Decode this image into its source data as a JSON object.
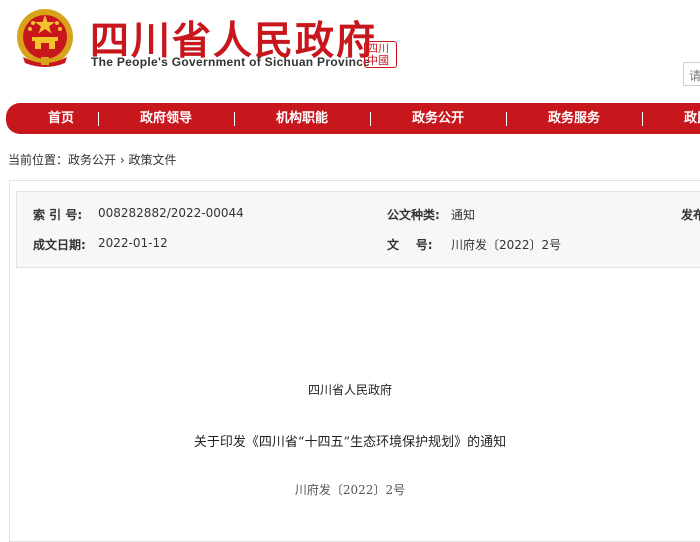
{
  "header": {
    "title_cn": "四川省人民政府",
    "title_en": "The People's Government of Sichuan Province",
    "seal_text": "四川中國",
    "search_placeholder": "请",
    "brand_color": "#c8161d"
  },
  "nav": {
    "items": [
      {
        "label": "首页"
      },
      {
        "label": "政府领导"
      },
      {
        "label": "机构职能"
      },
      {
        "label": "政务公开"
      },
      {
        "label": "政务服务"
      },
      {
        "label": "政民"
      }
    ],
    "separator": "|"
  },
  "breadcrumb": {
    "prefix": "当前位置：",
    "item1": "政务公开",
    "sep": " › ",
    "item2": "政策文件"
  },
  "meta": {
    "index_label": "索 引 号:",
    "index_value": "008282882/2022-00044",
    "type_label": "公文种类:",
    "type_value": "通知",
    "publish_label": "发布",
    "date_label": "成文日期:",
    "date_value": "2022-01-12",
    "docno_label": "文    号:",
    "docno_value": "川府发〔2022〕2号"
  },
  "document": {
    "issuer": "四川省人民政府",
    "title": "关于印发《四川省“十四五”生态环境保护规划》的通知",
    "number": "川府发〔2022〕2号"
  },
  "icons": {
    "emblem": "national-emblem-icon"
  }
}
